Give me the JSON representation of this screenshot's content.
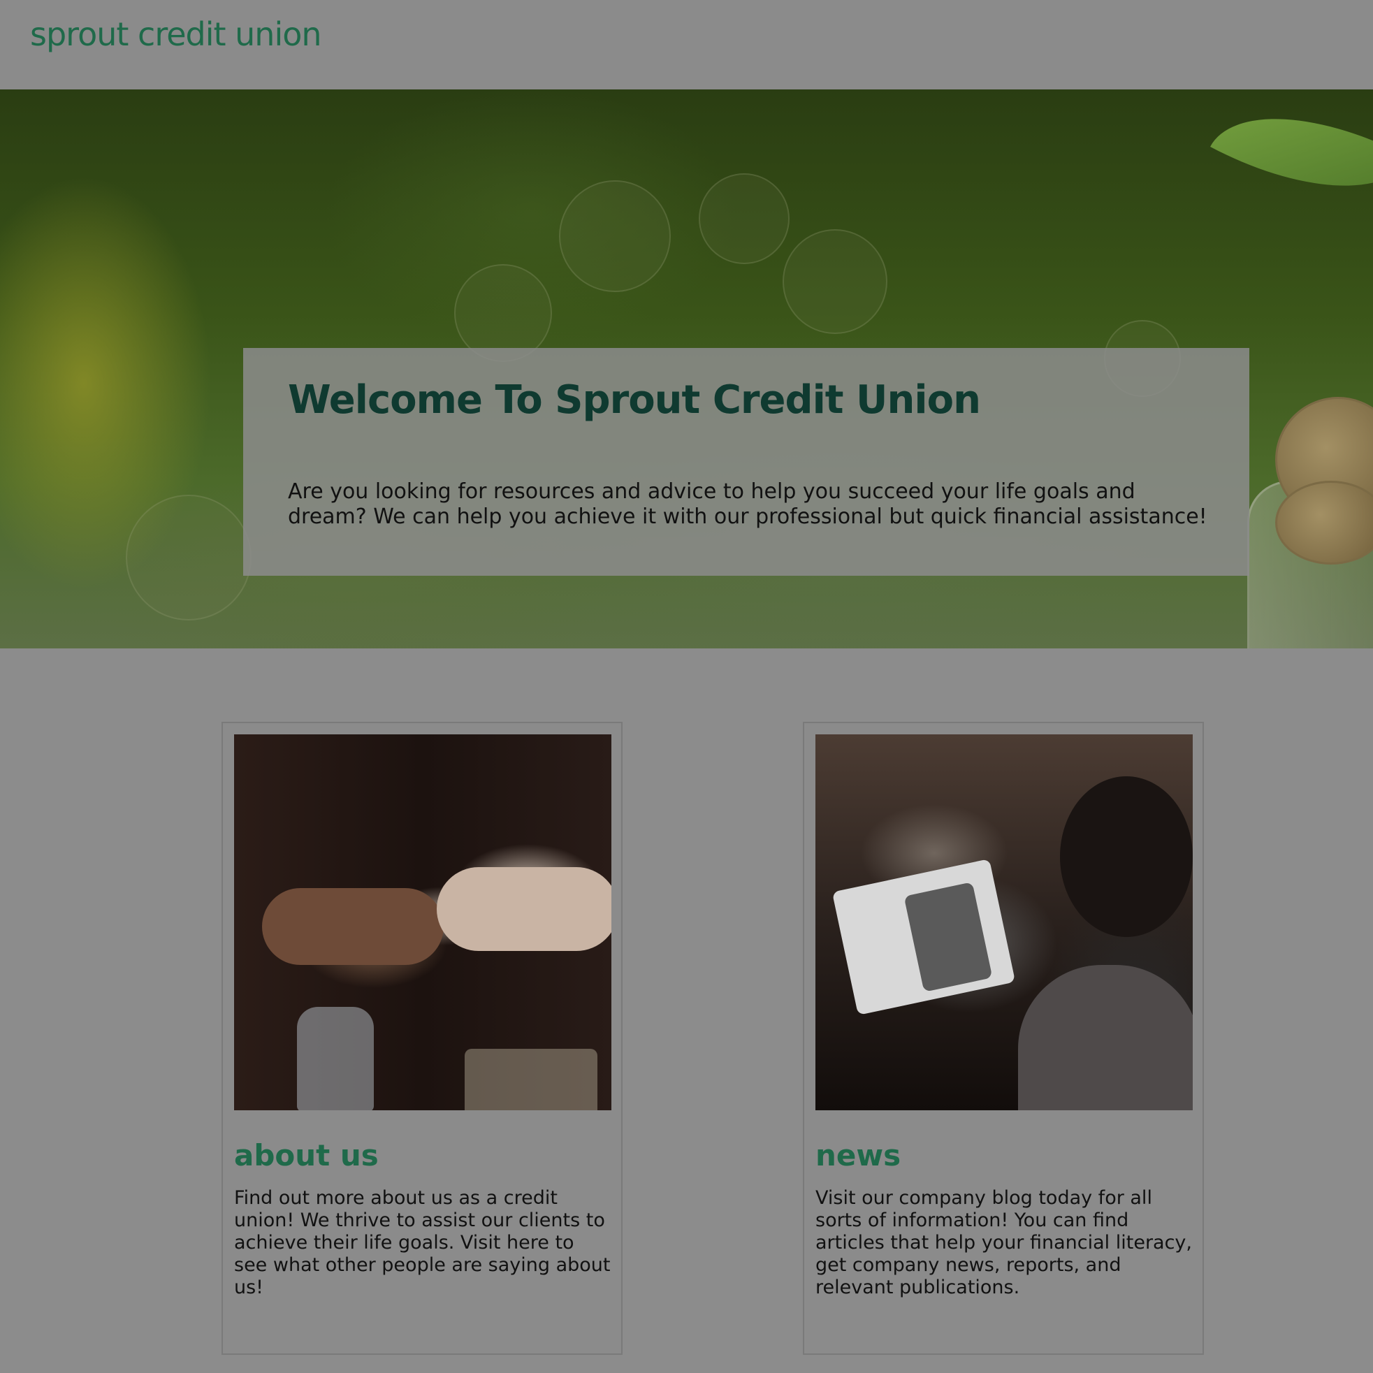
{
  "site": {
    "logo": "sprout credit union"
  },
  "hero": {
    "title": "Welcome To Sprout Credit Union",
    "text": "Are you looking for resources and advice to help you succeed your life goals and dream? We can help you achieve it with our professional but quick financial assistance!"
  },
  "cards": [
    {
      "title": "about us",
      "text": "Find out more about us as a credit union! We thrive to assist our clients to achieve their life goals. Visit here to see what other people are saying about us!"
    },
    {
      "title": "news",
      "text": "Visit our company blog today for all sorts of information! You can find articles that help your financial literacy, get company news, reports, and relevant publications."
    }
  ],
  "colors": {
    "brand_green": "#1f6a4a",
    "hero_title": "#0f3a30",
    "overlay_gray": "#8c8c8c"
  }
}
